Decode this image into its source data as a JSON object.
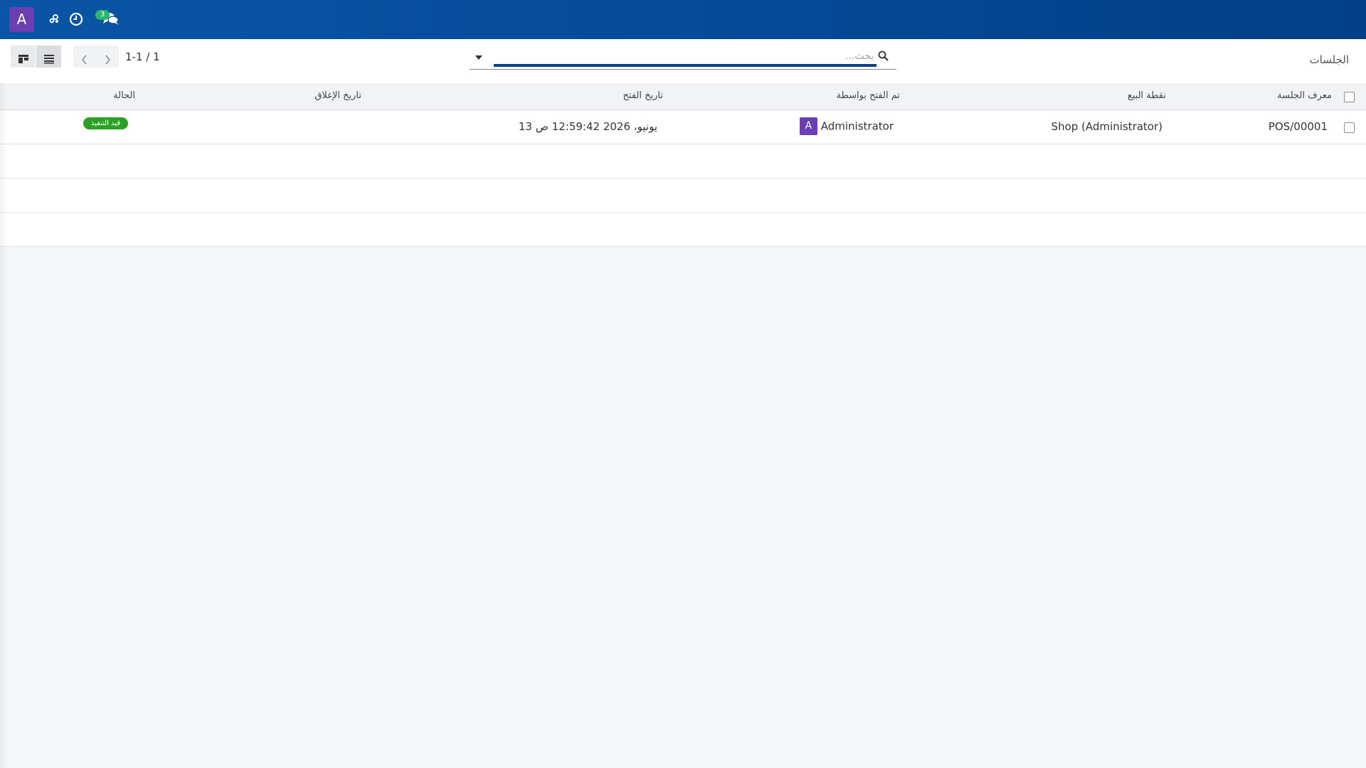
{
  "navbar": {
    "user_initial": "A",
    "icons": [
      "activity-icon",
      "clock-icon",
      "chat-icon"
    ],
    "chat_badge_count": "3",
    "colors": {
      "bar": "#044a97",
      "avatar": "#6b3fb1",
      "badge": "#2db56a"
    }
  },
  "control_panel": {
    "breadcrumb": "الجلسات",
    "search": {
      "placeholder": "بحث..."
    },
    "pager": {
      "value": "1-1 / 1"
    },
    "views": [
      "kanban-view-icon",
      "list-view-icon"
    ]
  },
  "table": {
    "columns": {
      "session_id": "معرف الجلسة",
      "point_of_sale": "نقطة البيع",
      "opened_by": "تم الفتح بواسطة",
      "opening_date": "تاريخ الفتح",
      "closing_date": "تاريخ الإغلاق",
      "status": "الحالة"
    },
    "rows": [
      {
        "session_id": "POS/00001",
        "point_of_sale": "Shop (Administrator)",
        "opened_by_initial": "A",
        "opened_by": "Administrator",
        "opening_date": "13 يونيو، 2026 12:59:42 ص",
        "closing_date": "",
        "status": "قيد التنفيذ"
      }
    ],
    "colors": {
      "status_badge": "#2ca024"
    }
  }
}
